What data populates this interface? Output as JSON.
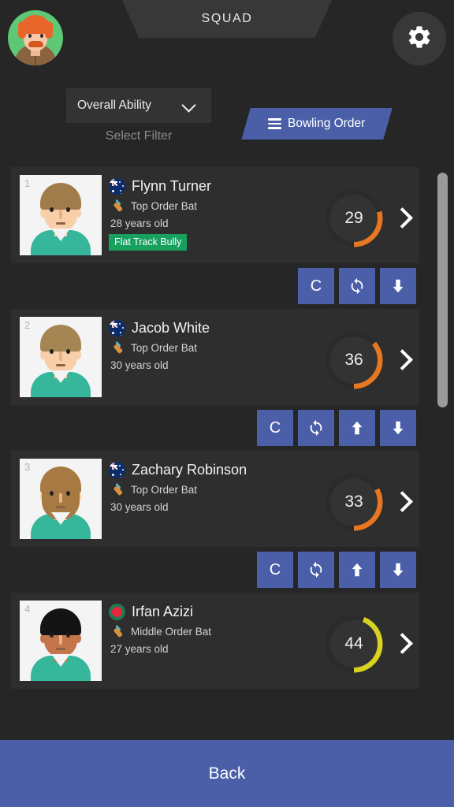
{
  "header": {
    "tab_title": "SQUAD",
    "avatar_icon": "user-avatar",
    "settings_icon": "gear-icon"
  },
  "filter": {
    "selected": "Overall Ability",
    "caption": "Select Filter",
    "chevron_icon": "chevron-down-icon",
    "bowling_order_label": "Bowling Order",
    "bowling_order_icon": "hamburger-icon"
  },
  "colors": {
    "accent_blue": "#4a5fa8",
    "rating_orange": "#e87722",
    "rating_yellow": "#d8d320",
    "trait_green": "#17a05e",
    "card_bg": "#2e2e2e",
    "page_bg": "#262626"
  },
  "players": [
    {
      "rank": "1",
      "name": "Flynn Turner",
      "nationality_icon": "flag-australia-icon",
      "role": "Top Order Bat",
      "role_icon": "cricket-bat-icon",
      "age": "28 years old",
      "trait": "Flat Track Bully",
      "rating": "29",
      "rating_color": "#e87722",
      "actions": [
        "captain",
        "swap",
        "move-down"
      ]
    },
    {
      "rank": "2",
      "name": "Jacob White",
      "nationality_icon": "flag-australia-icon",
      "role": "Top Order Bat",
      "role_icon": "cricket-bat-icon",
      "age": "30 years old",
      "trait": "",
      "rating": "36",
      "rating_color": "#e87722",
      "actions": [
        "captain",
        "swap",
        "move-up",
        "move-down"
      ]
    },
    {
      "rank": "3",
      "name": "Zachary Robinson",
      "nationality_icon": "flag-australia-icon",
      "role": "Top Order Bat",
      "role_icon": "cricket-bat-icon",
      "age": "30 years old",
      "trait": "",
      "rating": "33",
      "rating_color": "#e87722",
      "actions": [
        "captain",
        "swap",
        "move-up",
        "move-down"
      ]
    },
    {
      "rank": "4",
      "name": "Irfan Azizi",
      "nationality_icon": "flag-bangladesh-icon",
      "role": "Middle Order Bat",
      "role_icon": "cricket-bat-icon",
      "age": "27 years old",
      "trait": "",
      "rating": "44",
      "rating_color": "#d8d320",
      "actions": []
    }
  ],
  "action_labels": {
    "captain": "C",
    "swap": "swap-icon",
    "move_up": "arrow-up-icon",
    "move_down": "arrow-down-icon"
  },
  "footer": {
    "back_label": "Back"
  },
  "scroll": {
    "thumb_top_pct": "1",
    "thumb_height_pct": "41"
  }
}
